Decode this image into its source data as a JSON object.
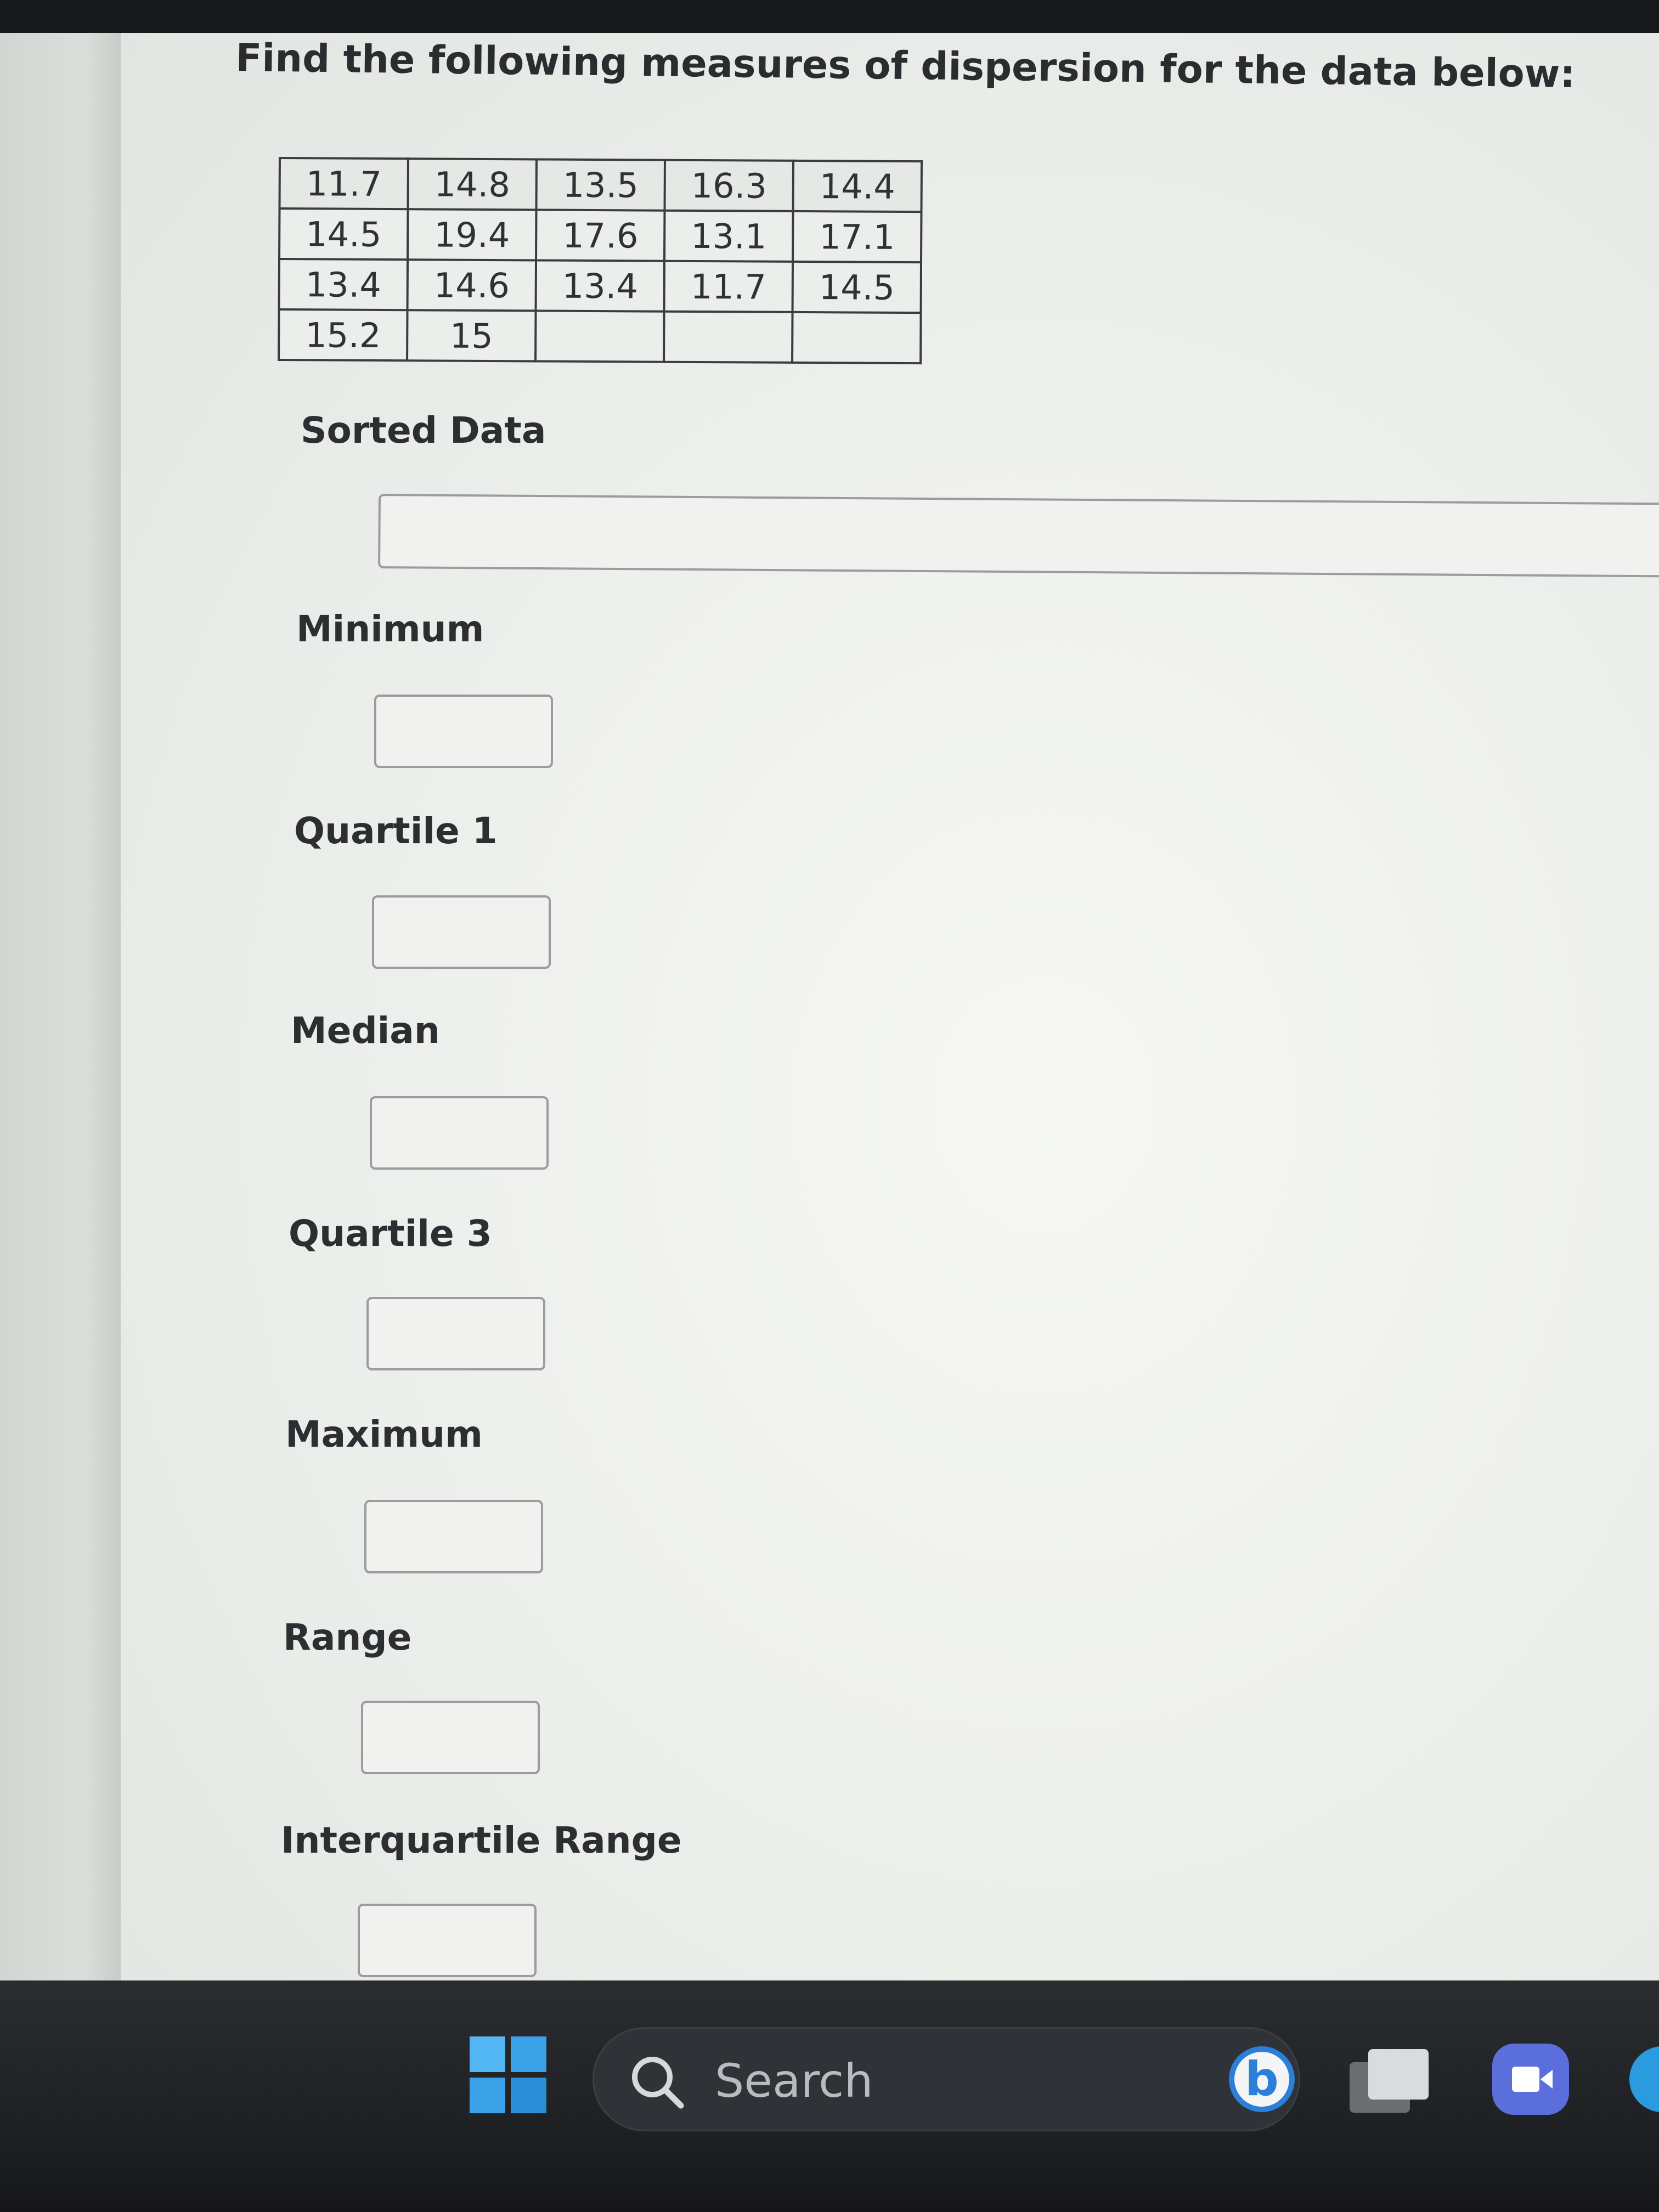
{
  "question": {
    "title": "Find the following measures of dispersion for the data below:"
  },
  "data_table": {
    "rows": [
      [
        "11.7",
        "14.8",
        "13.5",
        "16.3",
        "14.4"
      ],
      [
        "14.5",
        "19.4",
        "17.6",
        "13.1",
        "17.1"
      ],
      [
        "13.4",
        "14.6",
        "13.4",
        "11.7",
        "14.5"
      ],
      [
        "15.2",
        "15",
        "",
        "",
        ""
      ]
    ]
  },
  "fields": {
    "sorted_data": {
      "label": "Sorted Data",
      "value": ""
    },
    "minimum": {
      "label": "Minimum",
      "value": ""
    },
    "quartile_1": {
      "label": "Quartile 1",
      "value": ""
    },
    "median": {
      "label": "Median",
      "value": ""
    },
    "quartile_3": {
      "label": "Quartile 3",
      "value": ""
    },
    "maximum": {
      "label": "Maximum",
      "value": ""
    },
    "range": {
      "label": "Range",
      "value": ""
    },
    "interquartile_range": {
      "label": "Interquartile Range",
      "value": ""
    }
  },
  "taskbar": {
    "search_label": "Search",
    "icons": [
      "windows-start-icon",
      "search-icon",
      "bing-icon",
      "task-view-icon",
      "meet-icon",
      "edge-icon"
    ],
    "colors": {
      "start": "#3aa3e8",
      "bing": "#2c7fd8",
      "meet": "#5b6fdc"
    }
  }
}
